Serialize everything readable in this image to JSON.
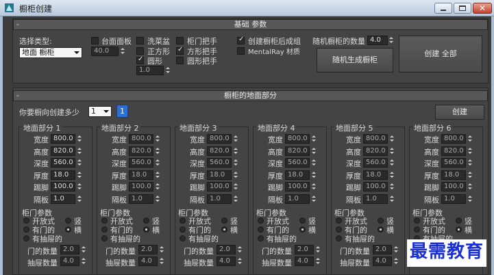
{
  "window": {
    "title": "橱柜创建"
  },
  "basic": {
    "rollout_title": "基础 参数",
    "type_label": "选择类型:",
    "type_value": "地面 橱柜",
    "countertop": "台面面板",
    "countertop_value": "40.0",
    "sink": "洗菜盆",
    "square": "正方形",
    "round": "圆形",
    "round_value": "1.0",
    "door_handle": "柜门把手",
    "square_handle": "方形把手",
    "round_handle": "圆形把手",
    "create_group": "创建橱柜后成组",
    "mentalray": "MentalRay 材质",
    "random_count_label": "随机橱柜的数量",
    "random_count_value": "4.0",
    "random_btn": "随机生成橱柜",
    "create_all_btn": "创建 全部"
  },
  "ground": {
    "rollout_title": "橱柜的地面部分",
    "how_many_label": "你要橱向创建多少",
    "how_many_value": "1",
    "page_badge": "1",
    "create_btn": "创建",
    "field_labels": [
      "宽度",
      "高度",
      "深度",
      "厚度",
      "踢脚",
      "隔板"
    ],
    "door_params_label": "柜门参数",
    "opt_open": "开放式",
    "opt_vertical": "竖",
    "opt_door": "有门的",
    "opt_horizontal": "横",
    "opt_drawer": "有抽屉的",
    "door_count_label": "门的数量",
    "drawer_count_label": "抽屉数量",
    "sections": [
      {
        "title": "地面部分 1",
        "values": [
          "800.0",
          "820.0",
          "560.0",
          "18.0",
          "100.0",
          "1.0"
        ],
        "door_count": "2.0",
        "drawer_count": "4.0"
      },
      {
        "title": "地面部分 2",
        "values": [
          "800.0",
          "820.0",
          "560.0",
          "18.0",
          "100.0",
          "1.0"
        ],
        "door_count": "2.0",
        "drawer_count": "4.0"
      },
      {
        "title": "地面部分 3",
        "values": [
          "800.0",
          "820.0",
          "560.0",
          "18.0",
          "100.0",
          "1.0"
        ],
        "door_count": "2.0",
        "drawer_count": "4.0"
      },
      {
        "title": "地面部分 4",
        "values": [
          "800.0",
          "820.0",
          "560.0",
          "18.0",
          "100.0",
          "1.0"
        ],
        "door_count": "2.0",
        "drawer_count": "4.0"
      },
      {
        "title": "地面部分 5",
        "values": [
          "800.0",
          "820.0",
          "560.0",
          "18.0",
          "100.0",
          "1.0"
        ],
        "door_count": "2.0",
        "drawer_count": "4.0"
      },
      {
        "title": "地面部分 6",
        "values": [
          "800.0",
          "820.0",
          "560.0",
          "18.0",
          "100.0",
          "1.0"
        ],
        "door_count": "2.0",
        "drawer_count": "4.0"
      }
    ]
  },
  "watermark": "最需教育"
}
